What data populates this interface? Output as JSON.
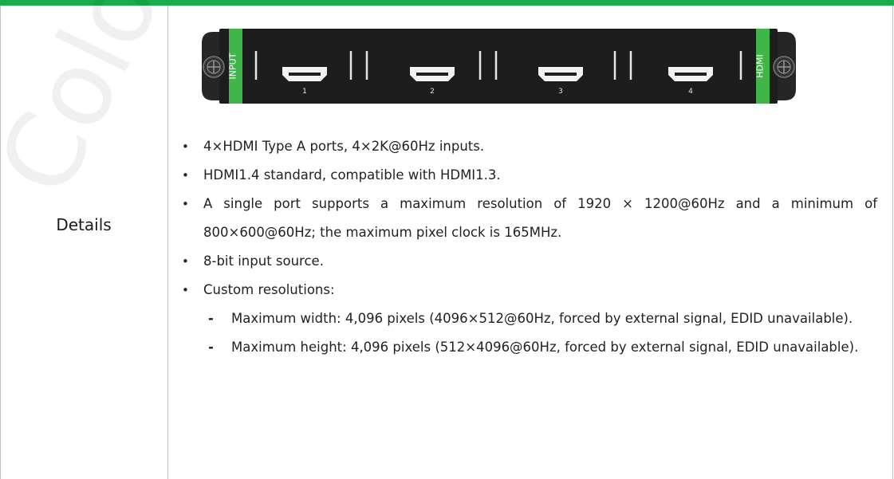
{
  "row_label": "Details",
  "watermark": "Color",
  "card": {
    "left_tab": "INPUT",
    "right_tab": "HDMI",
    "ports": [
      "1",
      "2",
      "3",
      "4"
    ]
  },
  "details": {
    "bullets": [
      "4×HDMI Type A ports, 4×2K@60Hz inputs.",
      "HDMI1.4 standard, compatible with HDMI1.3.",
      "A single port supports a maximum resolution of 1920 × 1200@60Hz and a minimum of 800×600@60Hz; the maximum pixel clock is 165MHz.",
      "8-bit input source.",
      "Custom resolutions:"
    ],
    "sub_bullets": [
      "Maximum width: 4,096 pixels (4096×512@60Hz, forced by external signal, EDID unavailable).",
      "Maximum height: 4,096 pixels (512×4096@60Hz, forced by external signal, EDID unavailable)."
    ]
  },
  "colors": {
    "accent_green": "#17ad4a",
    "panel": "#1d1d1d",
    "tab_green": "#3eb649",
    "border": "#bfbfbf"
  },
  "icons": [
    "bullet-dot-icon",
    "dash-icon",
    "hdmi-port-icon",
    "thumbscrew-icon"
  ]
}
